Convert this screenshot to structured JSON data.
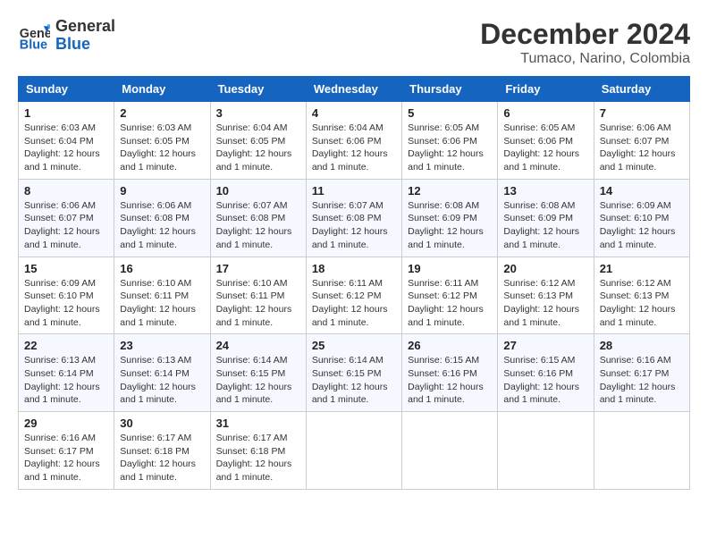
{
  "logo": {
    "text_general": "General",
    "text_blue": "Blue"
  },
  "title": "December 2024",
  "subtitle": "Tumaco, Narino, Colombia",
  "days_of_week": [
    "Sunday",
    "Monday",
    "Tuesday",
    "Wednesday",
    "Thursday",
    "Friday",
    "Saturday"
  ],
  "weeks": [
    [
      {
        "day": "1",
        "sunrise": "6:03 AM",
        "sunset": "6:04 PM",
        "daylight": "12 hours and 1 minute."
      },
      {
        "day": "2",
        "sunrise": "6:03 AM",
        "sunset": "6:05 PM",
        "daylight": "12 hours and 1 minute."
      },
      {
        "day": "3",
        "sunrise": "6:04 AM",
        "sunset": "6:05 PM",
        "daylight": "12 hours and 1 minute."
      },
      {
        "day": "4",
        "sunrise": "6:04 AM",
        "sunset": "6:06 PM",
        "daylight": "12 hours and 1 minute."
      },
      {
        "day": "5",
        "sunrise": "6:05 AM",
        "sunset": "6:06 PM",
        "daylight": "12 hours and 1 minute."
      },
      {
        "day": "6",
        "sunrise": "6:05 AM",
        "sunset": "6:06 PM",
        "daylight": "12 hours and 1 minute."
      },
      {
        "day": "7",
        "sunrise": "6:06 AM",
        "sunset": "6:07 PM",
        "daylight": "12 hours and 1 minute."
      }
    ],
    [
      {
        "day": "8",
        "sunrise": "6:06 AM",
        "sunset": "6:07 PM",
        "daylight": "12 hours and 1 minute."
      },
      {
        "day": "9",
        "sunrise": "6:06 AM",
        "sunset": "6:08 PM",
        "daylight": "12 hours and 1 minute."
      },
      {
        "day": "10",
        "sunrise": "6:07 AM",
        "sunset": "6:08 PM",
        "daylight": "12 hours and 1 minute."
      },
      {
        "day": "11",
        "sunrise": "6:07 AM",
        "sunset": "6:08 PM",
        "daylight": "12 hours and 1 minute."
      },
      {
        "day": "12",
        "sunrise": "6:08 AM",
        "sunset": "6:09 PM",
        "daylight": "12 hours and 1 minute."
      },
      {
        "day": "13",
        "sunrise": "6:08 AM",
        "sunset": "6:09 PM",
        "daylight": "12 hours and 1 minute."
      },
      {
        "day": "14",
        "sunrise": "6:09 AM",
        "sunset": "6:10 PM",
        "daylight": "12 hours and 1 minute."
      }
    ],
    [
      {
        "day": "15",
        "sunrise": "6:09 AM",
        "sunset": "6:10 PM",
        "daylight": "12 hours and 1 minute."
      },
      {
        "day": "16",
        "sunrise": "6:10 AM",
        "sunset": "6:11 PM",
        "daylight": "12 hours and 1 minute."
      },
      {
        "day": "17",
        "sunrise": "6:10 AM",
        "sunset": "6:11 PM",
        "daylight": "12 hours and 1 minute."
      },
      {
        "day": "18",
        "sunrise": "6:11 AM",
        "sunset": "6:12 PM",
        "daylight": "12 hours and 1 minute."
      },
      {
        "day": "19",
        "sunrise": "6:11 AM",
        "sunset": "6:12 PM",
        "daylight": "12 hours and 1 minute."
      },
      {
        "day": "20",
        "sunrise": "6:12 AM",
        "sunset": "6:13 PM",
        "daylight": "12 hours and 1 minute."
      },
      {
        "day": "21",
        "sunrise": "6:12 AM",
        "sunset": "6:13 PM",
        "daylight": "12 hours and 1 minute."
      }
    ],
    [
      {
        "day": "22",
        "sunrise": "6:13 AM",
        "sunset": "6:14 PM",
        "daylight": "12 hours and 1 minute."
      },
      {
        "day": "23",
        "sunrise": "6:13 AM",
        "sunset": "6:14 PM",
        "daylight": "12 hours and 1 minute."
      },
      {
        "day": "24",
        "sunrise": "6:14 AM",
        "sunset": "6:15 PM",
        "daylight": "12 hours and 1 minute."
      },
      {
        "day": "25",
        "sunrise": "6:14 AM",
        "sunset": "6:15 PM",
        "daylight": "12 hours and 1 minute."
      },
      {
        "day": "26",
        "sunrise": "6:15 AM",
        "sunset": "6:16 PM",
        "daylight": "12 hours and 1 minute."
      },
      {
        "day": "27",
        "sunrise": "6:15 AM",
        "sunset": "6:16 PM",
        "daylight": "12 hours and 1 minute."
      },
      {
        "day": "28",
        "sunrise": "6:16 AM",
        "sunset": "6:17 PM",
        "daylight": "12 hours and 1 minute."
      }
    ],
    [
      {
        "day": "29",
        "sunrise": "6:16 AM",
        "sunset": "6:17 PM",
        "daylight": "12 hours and 1 minute."
      },
      {
        "day": "30",
        "sunrise": "6:17 AM",
        "sunset": "6:18 PM",
        "daylight": "12 hours and 1 minute."
      },
      {
        "day": "31",
        "sunrise": "6:17 AM",
        "sunset": "6:18 PM",
        "daylight": "12 hours and 1 minute."
      },
      null,
      null,
      null,
      null
    ]
  ]
}
